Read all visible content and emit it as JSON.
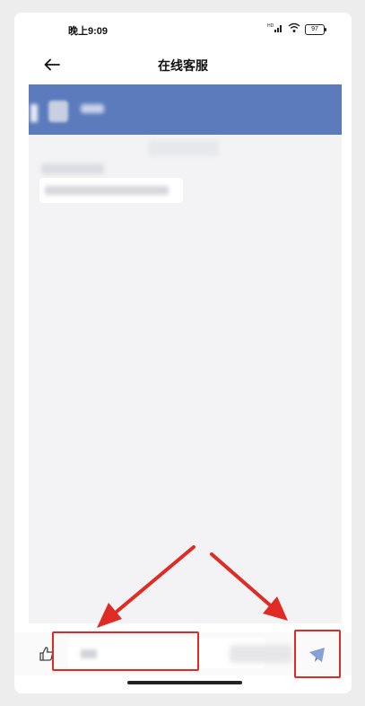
{
  "status_bar": {
    "time": "晚上9:09",
    "network": "HD",
    "battery": "97"
  },
  "nav": {
    "title": "在线客服"
  },
  "icons": {
    "back": "back-arrow-icon",
    "like": "thumbs-up-icon",
    "send": "send-icon",
    "signal": "signal-icon",
    "wifi": "wifi-icon"
  },
  "colors": {
    "header": "#5b7bbd",
    "annotation": "#e02a24"
  }
}
